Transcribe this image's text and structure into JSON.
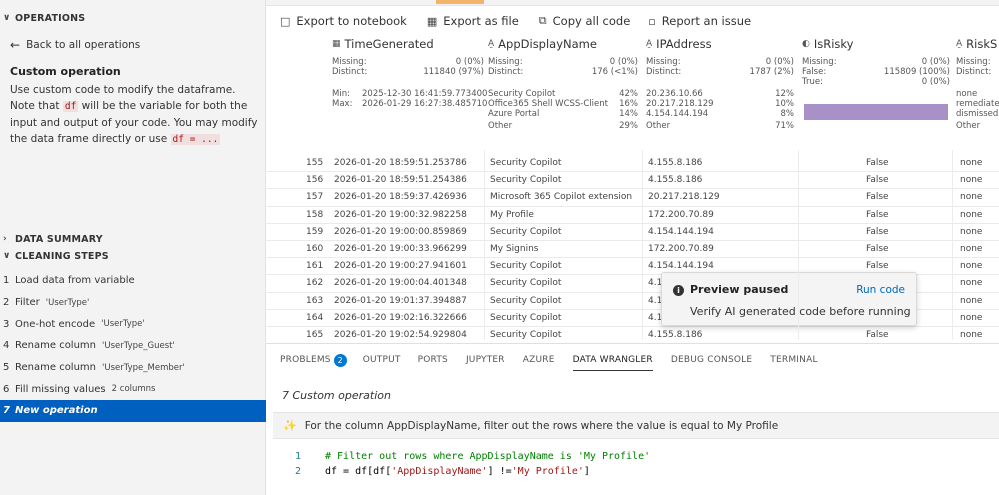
{
  "left": {
    "operations_header": "OPERATIONS",
    "back_label": "Back to all operations",
    "custom_title": "Custom operation",
    "desc_part1": "Use custom code to modify the dataframe. Note that",
    "desc_code1": "df",
    "desc_part2": "will be the variable for both the input and output of your code. You may modify the data frame directly or use",
    "desc_code2": "df = ...",
    "data_summary_header": "DATA SUMMARY",
    "cleaning_steps_header": "CLEANING STEPS",
    "steps": [
      {
        "num": "1",
        "label": "Load data from variable",
        "param": ""
      },
      {
        "num": "2",
        "label": "Filter",
        "param": "'UserType'"
      },
      {
        "num": "3",
        "label": "One-hot encode",
        "param": "'UserType'"
      },
      {
        "num": "4",
        "label": "Rename column",
        "param": "'UserType_Guest'"
      },
      {
        "num": "5",
        "label": "Rename column",
        "param": "'UserType_Member'"
      },
      {
        "num": "6",
        "label": "Fill missing values",
        "param": "2 columns"
      },
      {
        "num": "7",
        "label": "New operation",
        "param": ""
      }
    ]
  },
  "toolbar": {
    "export_notebook": "Export to notebook",
    "export_file": "Export as file",
    "copy_code": "Copy all code",
    "report_issue": "Report an issue"
  },
  "columns": [
    {
      "name": "TimeGenerated",
      "icon": "calendar-icon",
      "missing_label": "Missing:",
      "missing_value": "0 (0%)",
      "distinct_label": "Distinct:",
      "distinct_value": "111840 (97%)",
      "min_label": "Min:",
      "min_value": "2025-12-30 16:41:59.773400",
      "max_label": "Max:",
      "max_value": "2026-01-29 16:27:38.485710"
    },
    {
      "name": "AppDisplayName",
      "icon": "text-icon",
      "missing_label": "Missing:",
      "missing_value": "0 (0%)",
      "distinct_label": "Distinct:",
      "distinct_value": "176 (<1%)",
      "top": [
        {
          "label": "Security Copilot",
          "pct": "42%"
        },
        {
          "label": "Office365 Shell WCSS-Client",
          "pct": "16%"
        },
        {
          "label": "Azure Portal",
          "pct": "14%"
        },
        {
          "label": "Other",
          "pct": "29%"
        }
      ]
    },
    {
      "name": "IPAddress",
      "icon": "text-icon",
      "missing_label": "Missing:",
      "missing_value": "0 (0%)",
      "distinct_label": "Distinct:",
      "distinct_value": "1787 (2%)",
      "top": [
        {
          "label": "20.236.10.66",
          "pct": "12%"
        },
        {
          "label": "20.217.218.129",
          "pct": "10%"
        },
        {
          "label": "4.154.144.194",
          "pct": "8%"
        },
        {
          "label": "Other",
          "pct": "71%"
        }
      ]
    },
    {
      "name": "IsRisky",
      "icon": "boolean-icon",
      "missing_label": "Missing:",
      "missing_value": "0 (0%)",
      "false_label": "False:",
      "false_value": "115809 (100%)",
      "true_label": "True:",
      "true_value": "0 (0%)",
      "false_fraction": 1.0
    },
    {
      "name": "RiskS",
      "icon": "text-icon",
      "missing_label": "Missing:",
      "distinct_label": "Distinct:",
      "top": [
        {
          "label": "none"
        },
        {
          "label": "remediate"
        },
        {
          "label": "dismissed"
        },
        {
          "label": "Other"
        }
      ]
    }
  ],
  "rows": [
    {
      "idx": "155",
      "time": "2026-01-20 18:59:51.253786",
      "app": "Security Copilot",
      "ip": "4.155.8.186",
      "risky": "False",
      "risk": "none"
    },
    {
      "idx": "156",
      "time": "2026-01-20 18:59:51.254386",
      "app": "Security Copilot",
      "ip": "4.155.8.186",
      "risky": "False",
      "risk": "none"
    },
    {
      "idx": "157",
      "time": "2026-01-20 18:59:37.426936",
      "app": "Microsoft 365 Copilot extension",
      "ip": "20.217.218.129",
      "risky": "False",
      "risk": "none"
    },
    {
      "idx": "158",
      "time": "2026-01-20 19:00:32.982258",
      "app": "My Profile",
      "ip": "172.200.70.89",
      "risky": "False",
      "risk": "none"
    },
    {
      "idx": "159",
      "time": "2026-01-20 19:00:00.859869",
      "app": "Security Copilot",
      "ip": "4.154.144.194",
      "risky": "False",
      "risk": "none"
    },
    {
      "idx": "160",
      "time": "2026-01-20 19:00:33.966299",
      "app": "My Signins",
      "ip": "172.200.70.89",
      "risky": "False",
      "risk": "none"
    },
    {
      "idx": "161",
      "time": "2026-01-20 19:00:27.941601",
      "app": "Security Copilot",
      "ip": "4.154.144.194",
      "risky": "False",
      "risk": "none"
    },
    {
      "idx": "162",
      "time": "2026-01-20 19:00:04.401348",
      "app": "Security Copilot",
      "ip": "4.15",
      "risky": "",
      "risk": "none"
    },
    {
      "idx": "163",
      "time": "2026-01-20 19:01:37.394887",
      "app": "Security Copilot",
      "ip": "4.15",
      "risky": "",
      "risk": "none"
    },
    {
      "idx": "164",
      "time": "2026-01-20 19:02:16.322666",
      "app": "Security Copilot",
      "ip": "4.15",
      "risky": "",
      "risk": "none"
    },
    {
      "idx": "165",
      "time": "2026-01-20 19:02:54.929804",
      "app": "Security Copilot",
      "ip": "4.155.8.186",
      "risky": "False",
      "risk": "none"
    }
  ],
  "toast": {
    "title": "Preview paused",
    "action": "Run code",
    "message": "Verify AI generated code before running",
    "icon": "info-icon"
  },
  "bottom": {
    "tabs": [
      {
        "label": "PROBLEMS",
        "badge": "2"
      },
      {
        "label": "OUTPUT"
      },
      {
        "label": "PORTS"
      },
      {
        "label": "JUPYTER"
      },
      {
        "label": "AZURE"
      },
      {
        "label": "DATA WRANGLER",
        "active": true
      },
      {
        "label": "DEBUG CONSOLE"
      },
      {
        "label": "TERMINAL"
      }
    ],
    "op_title": "7  Custom operation",
    "prompt": "For the column AppDisplayName, filter out the rows where the value is equal to My Profile",
    "code": [
      {
        "ln": "1",
        "text": "# Filter out rows where AppDisplayName is 'My Profile'"
      },
      {
        "ln": "2",
        "p1": "df = df[df[",
        "s1": "'AppDisplayName'",
        "p2": "] != ",
        "s2": "'My Profile'",
        "p3": "]"
      }
    ]
  },
  "colors": {
    "accent": "#0060c0",
    "badge": "#0078d4",
    "link": "#0066b8",
    "bar": "#a890c8"
  }
}
